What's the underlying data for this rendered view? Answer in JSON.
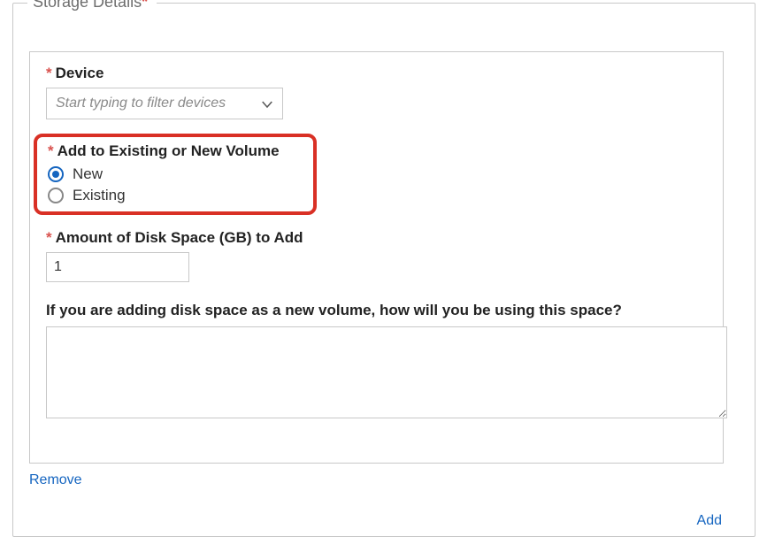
{
  "section": {
    "title": "Storage Details",
    "required_marker": "*"
  },
  "device": {
    "label": "Device",
    "placeholder": "Start typing to filter devices"
  },
  "volume": {
    "label": "Add to Existing or New Volume",
    "options": {
      "new": "New",
      "existing": "Existing"
    },
    "selected": "new"
  },
  "disk_space": {
    "label": "Amount of Disk Space (GB) to Add",
    "value": "1"
  },
  "usage": {
    "label": "If you are adding disk space as a new volume, how will you be using this space?",
    "value": ""
  },
  "actions": {
    "remove": "Remove",
    "add": "Add"
  }
}
